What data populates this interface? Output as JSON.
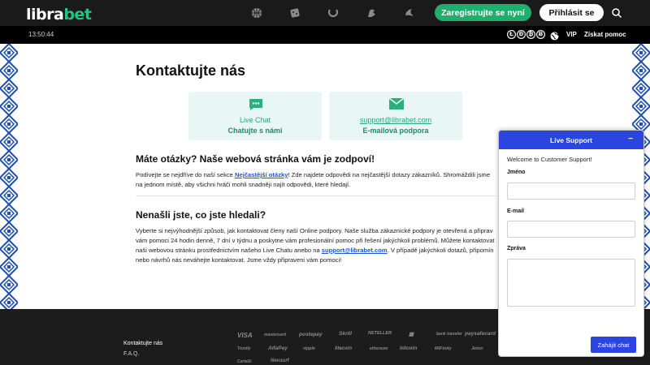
{
  "header": {
    "logo_part1": "libra",
    "logo_part2": "bet",
    "register_label": "Zaregistrujte se nyní",
    "login_label": "Přihlásit se",
    "nav_icons": [
      "basketball-icon",
      "dice-icon",
      "horseshoe-icon",
      "casino-chip-icon",
      "live-casino-icon"
    ]
  },
  "subbar": {
    "time": "13:50:44",
    "vip_label": "VIP",
    "help_label": "Získat pomoc",
    "coin_labels": [
      "Ł",
      "Ð",
      "₿",
      "Ƀ"
    ]
  },
  "main": {
    "title": "Kontaktujte nás",
    "cards": {
      "chat": {
        "line1": "Live Chat",
        "line2": "Chatujte s námi",
        "icon": "chat-bubble-icon"
      },
      "mail": {
        "line1": "support@librabet.com",
        "line2": "E-mailová podpora",
        "icon": "envelope-icon"
      }
    },
    "section1": {
      "title": "Máte otázky? Naše webová stránka vám je zodpoví!",
      "p1_a": "Podívejte se nejdříve do naší sekce ",
      "p1_link": "Nejčastější otázky",
      "p1_b": "! Zde najdete odpovědi na nejčastější dotazy zákazníků. Shromáždili jsme",
      "p2": "na jednom místě, aby všichni hráči mohli snadněji najít odpovědi, které hledají."
    },
    "section2": {
      "title": "Nenašli jste, co jste hledali?",
      "l1": "Vyberte si nejvýhodnější způsob, jak kontaktovat členy naší Online podpory. Naše služba zákaznické podpory je otevřená a připrav",
      "l2": "vám pomoci 24 hodin denně, 7 dní v týdnu a poskytne vám profesionální pomoc při řešení jakýchkoli problémů. Můžete kontaktovat",
      "l3_a": "naši webovou stránku prostřednictvím našeho Live Chatu anebo na ",
      "l3_link": "support@librabet.com",
      "l3_b": ". V případě jakýchkoli dotazů, připomín",
      "l4": "nebo návrhů nás neváhejte kontaktovat. Jsme vždy připraveni vám pomoci!"
    }
  },
  "footer": {
    "links": [
      "Kontaktujte nás",
      "F.A.Q."
    ],
    "payments_row1": [
      "VISA",
      "mastercard",
      "postepay",
      "Skrill",
      "NETELLER",
      "▦",
      "bank transfer",
      "paysafecard"
    ],
    "payments_row2": [
      "Trustly",
      "AlfaPay",
      "ripple",
      "litecoin",
      "ethereum",
      "bitcoin",
      "MiFinity",
      "Jeton"
    ],
    "payments_row3": [
      "CartaSi",
      "Neosurf"
    ]
  },
  "widget": {
    "title": "Live Support",
    "minimize": "−",
    "welcome": "Welcome to Customer Support!",
    "name_label": "Jméno",
    "email_label": "E-mail",
    "message_label": "Zpráva",
    "start_label": "Zahájit chat"
  },
  "colors": {
    "brand_green": "#1fae6e",
    "widget_blue": "#2a45e0",
    "card_bg": "#e8f6f6",
    "pattern_blue": "#1f4fb0"
  }
}
